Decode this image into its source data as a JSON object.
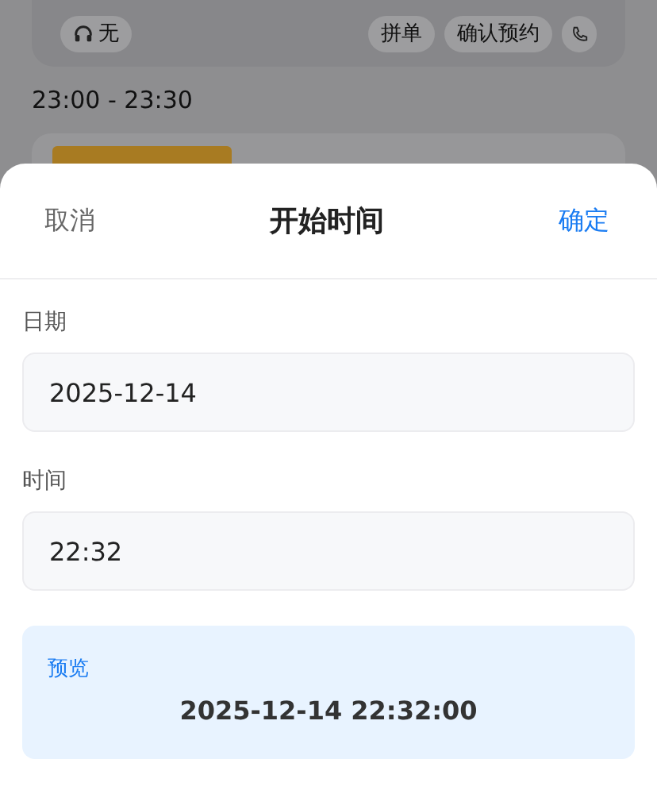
{
  "background": {
    "assistant": "无",
    "actions": [
      "拼单",
      "确认预约"
    ],
    "time_range": "23:00 - 23:30"
  },
  "sheet": {
    "cancel": "取消",
    "title": "开始时间",
    "confirm": "确定",
    "fields": [
      {
        "label": "日期",
        "value": "2025-12-14"
      },
      {
        "label": "时间",
        "value": "22:32"
      }
    ],
    "preview": {
      "label": "预览",
      "value": "2025-12-14 22:32:00"
    }
  }
}
